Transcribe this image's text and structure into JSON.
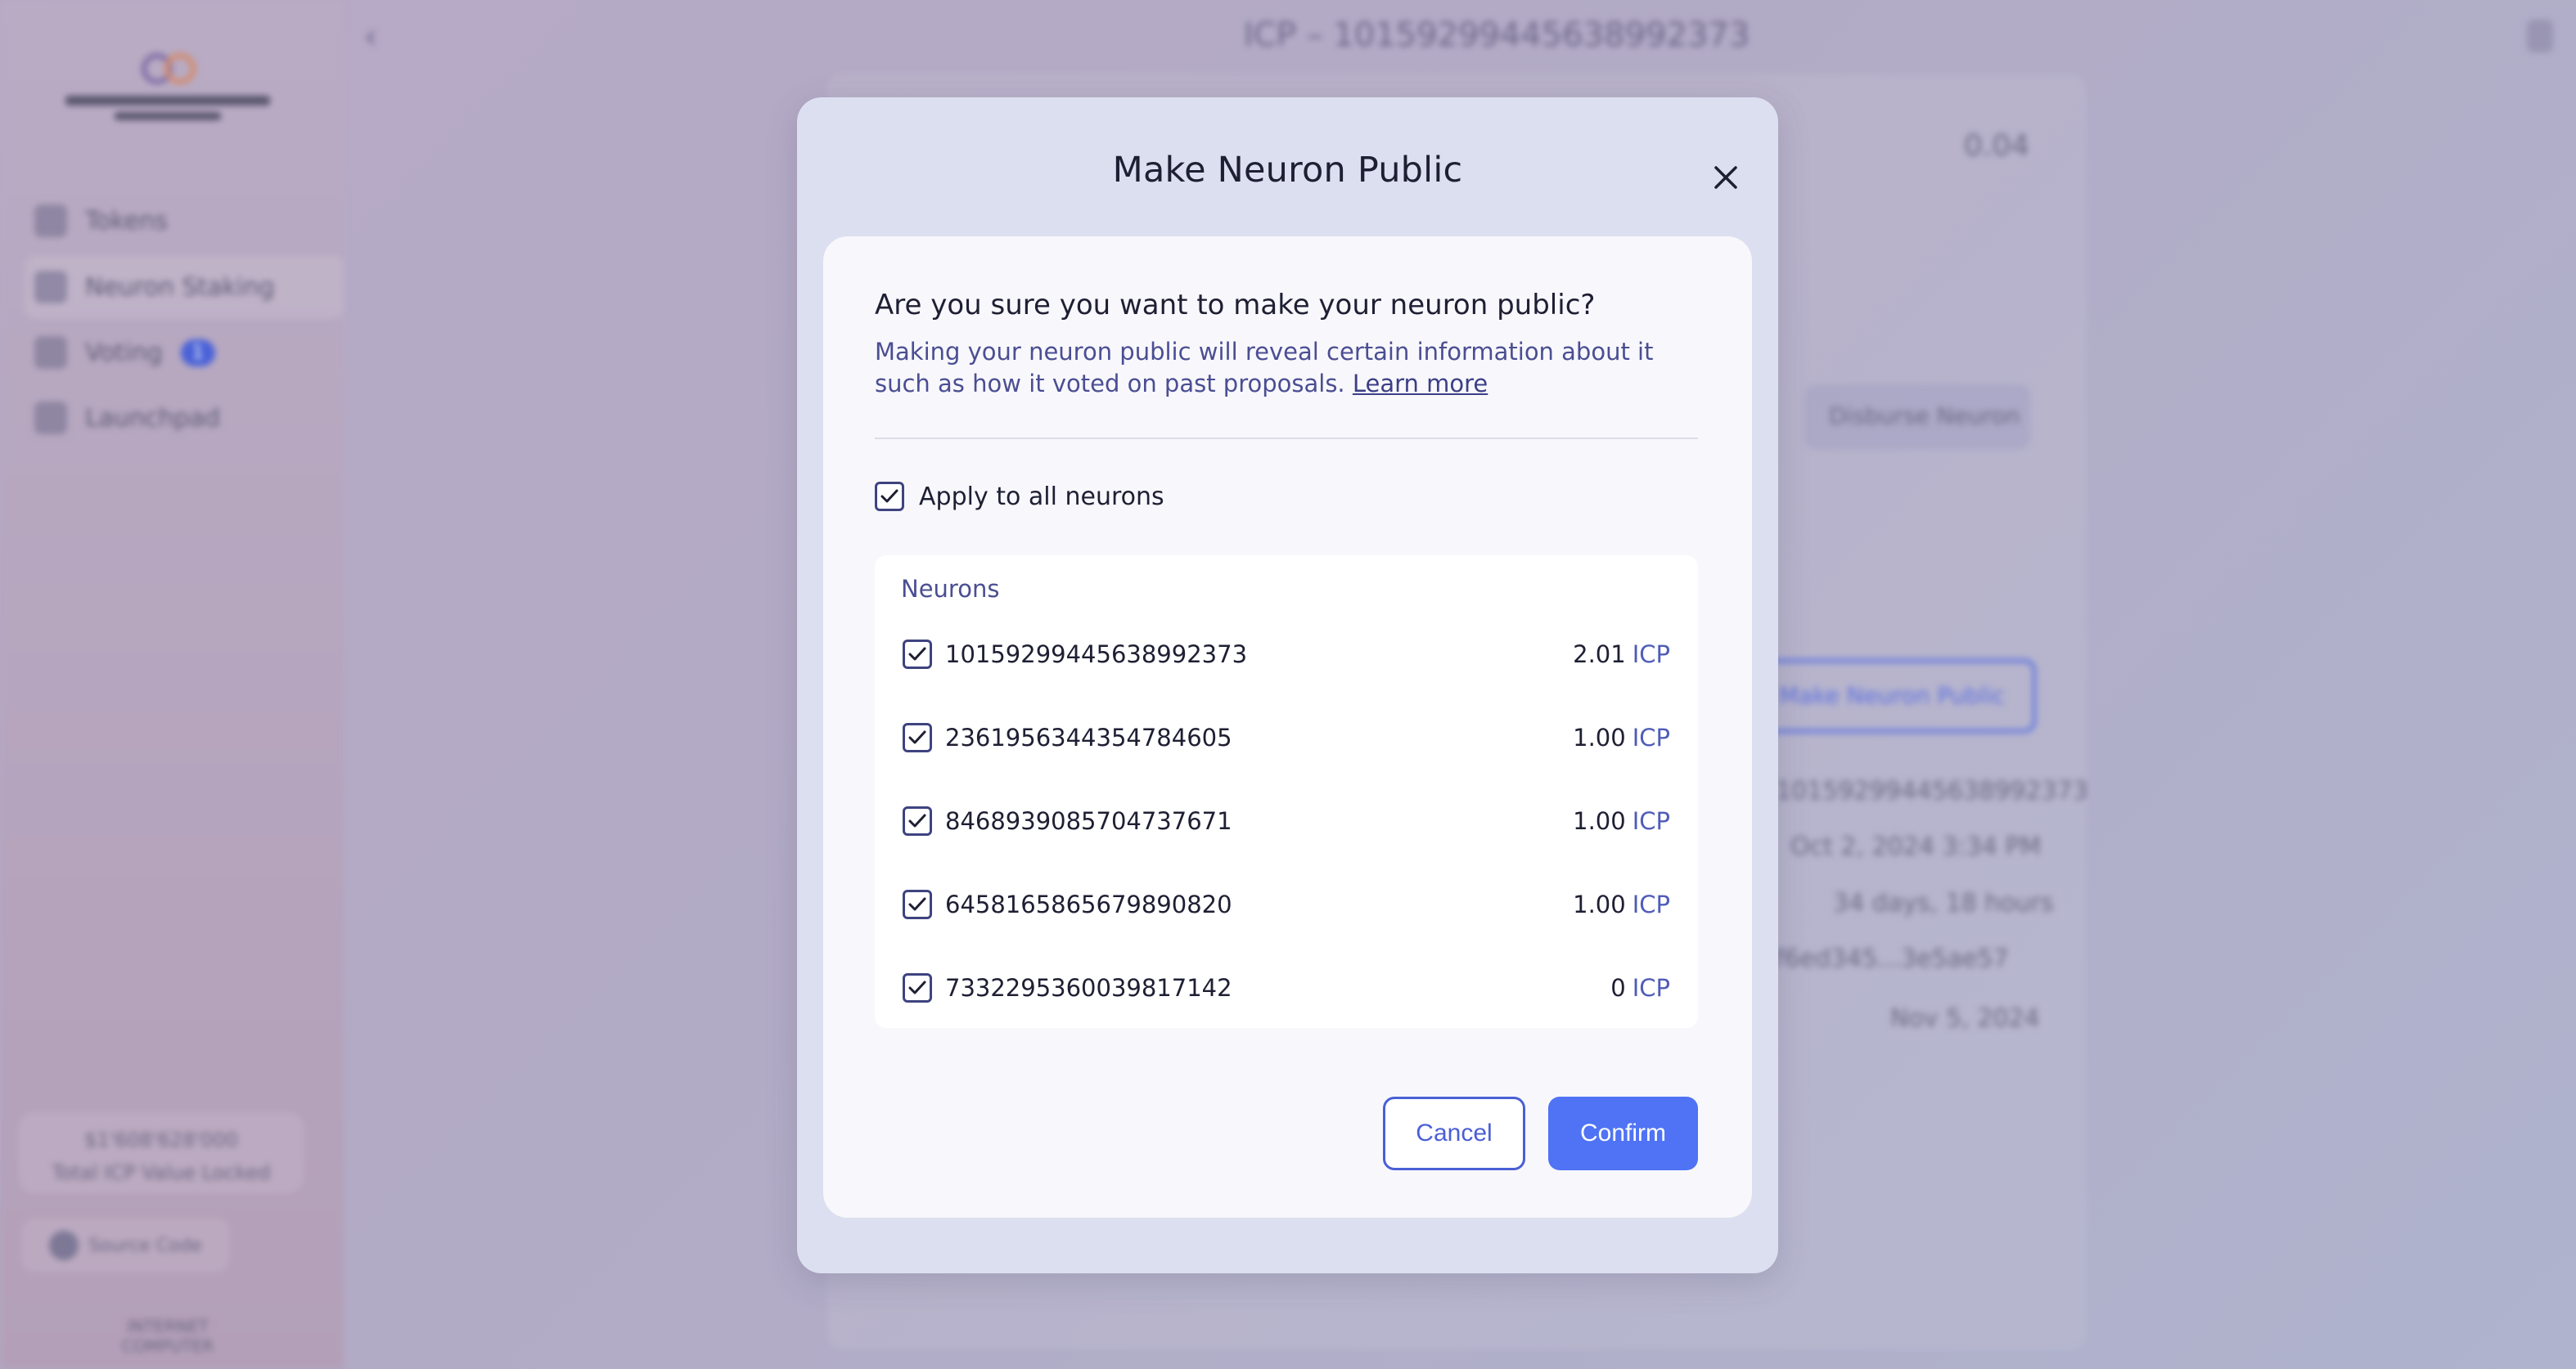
{
  "modal": {
    "title": "Make Neuron Public",
    "question": "Are you sure you want to make your neuron public?",
    "description": "Making your neuron public will reveal certain information about it such as how it voted on past proposals.",
    "learn_more": "Learn more",
    "apply_all": {
      "label": "Apply to all neurons",
      "checked": true
    },
    "neurons_label": "Neurons",
    "neurons": [
      {
        "id": "10159299445638992373",
        "amount": "2.01",
        "unit": "ICP",
        "checked": true
      },
      {
        "id": "2361956344354784605",
        "amount": "1.00",
        "unit": "ICP",
        "checked": true
      },
      {
        "id": "8468939085704737671",
        "amount": "1.00",
        "unit": "ICP",
        "checked": true
      },
      {
        "id": "6458165865679890820",
        "amount": "1.00",
        "unit": "ICP",
        "checked": true
      },
      {
        "id": "7332295360039817142",
        "amount": "0",
        "unit": "ICP",
        "checked": true
      }
    ],
    "cancel_label": "Cancel",
    "confirm_label": "Confirm"
  },
  "background": {
    "page_title": "ICP – 10159299445638992373",
    "balance": "0.04",
    "nav": [
      {
        "label": "Tokens"
      },
      {
        "label": "Neuron Staking"
      },
      {
        "label": "Voting",
        "badge": "1"
      },
      {
        "label": "Launchpad"
      }
    ],
    "tvl_value": "$1'608'628'000",
    "tvl_label": "Total ICP Value Locked",
    "source_code": "Source Code",
    "footer": "INTERNET COMPUTER",
    "disburse": "Disburse Neuron",
    "make_public": "Make Neuron Public",
    "details": [
      "10159299445638992373",
      "Oct 2, 2024 3:34 PM",
      "34 days, 18 hours",
      "f6ed345...3e5ae57",
      "Nov 5, 2024"
    ]
  },
  "colors": {
    "accent": "#4f73f4",
    "link": "#4a4e92",
    "modal_bg": "#dcdff0"
  }
}
